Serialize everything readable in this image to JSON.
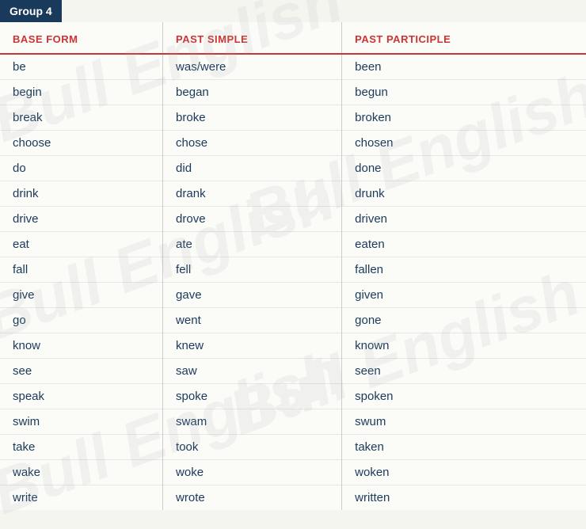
{
  "header": {
    "group_label": "Group 4"
  },
  "columns": {
    "base_form": "BASE FORM",
    "past_simple": "PAST SIMPLE",
    "past_participle": "PAST PARTICIPLE"
  },
  "rows": [
    {
      "base": "be",
      "past": "was/were",
      "participle": "been"
    },
    {
      "base": "begin",
      "past": "began",
      "participle": "begun"
    },
    {
      "base": "break",
      "past": "broke",
      "participle": "broken"
    },
    {
      "base": "choose",
      "past": "chose",
      "participle": "chosen"
    },
    {
      "base": "do",
      "past": "did",
      "participle": "done"
    },
    {
      "base": "drink",
      "past": "drank",
      "participle": "drunk"
    },
    {
      "base": "drive",
      "past": "drove",
      "participle": "driven"
    },
    {
      "base": "eat",
      "past": "ate",
      "participle": "eaten"
    },
    {
      "base": "fall",
      "past": "fell",
      "participle": "fallen"
    },
    {
      "base": "give",
      "past": "gave",
      "participle": "given"
    },
    {
      "base": "go",
      "past": "went",
      "participle": "gone"
    },
    {
      "base": "know",
      "past": "knew",
      "participle": "known"
    },
    {
      "base": "see",
      "past": "saw",
      "participle": "seen"
    },
    {
      "base": "speak",
      "past": "spoke",
      "participle": "spoken"
    },
    {
      "base": "swim",
      "past": "swam",
      "participle": "swum"
    },
    {
      "base": "take",
      "past": "took",
      "participle": "taken"
    },
    {
      "base": "wake",
      "past": "woke",
      "participle": "woken"
    },
    {
      "base": "write",
      "past": "wrote",
      "participle": "written"
    }
  ],
  "watermarks": [
    "Bull English",
    "Bull English",
    "Bull English",
    "Bull English",
    "Bull English"
  ]
}
